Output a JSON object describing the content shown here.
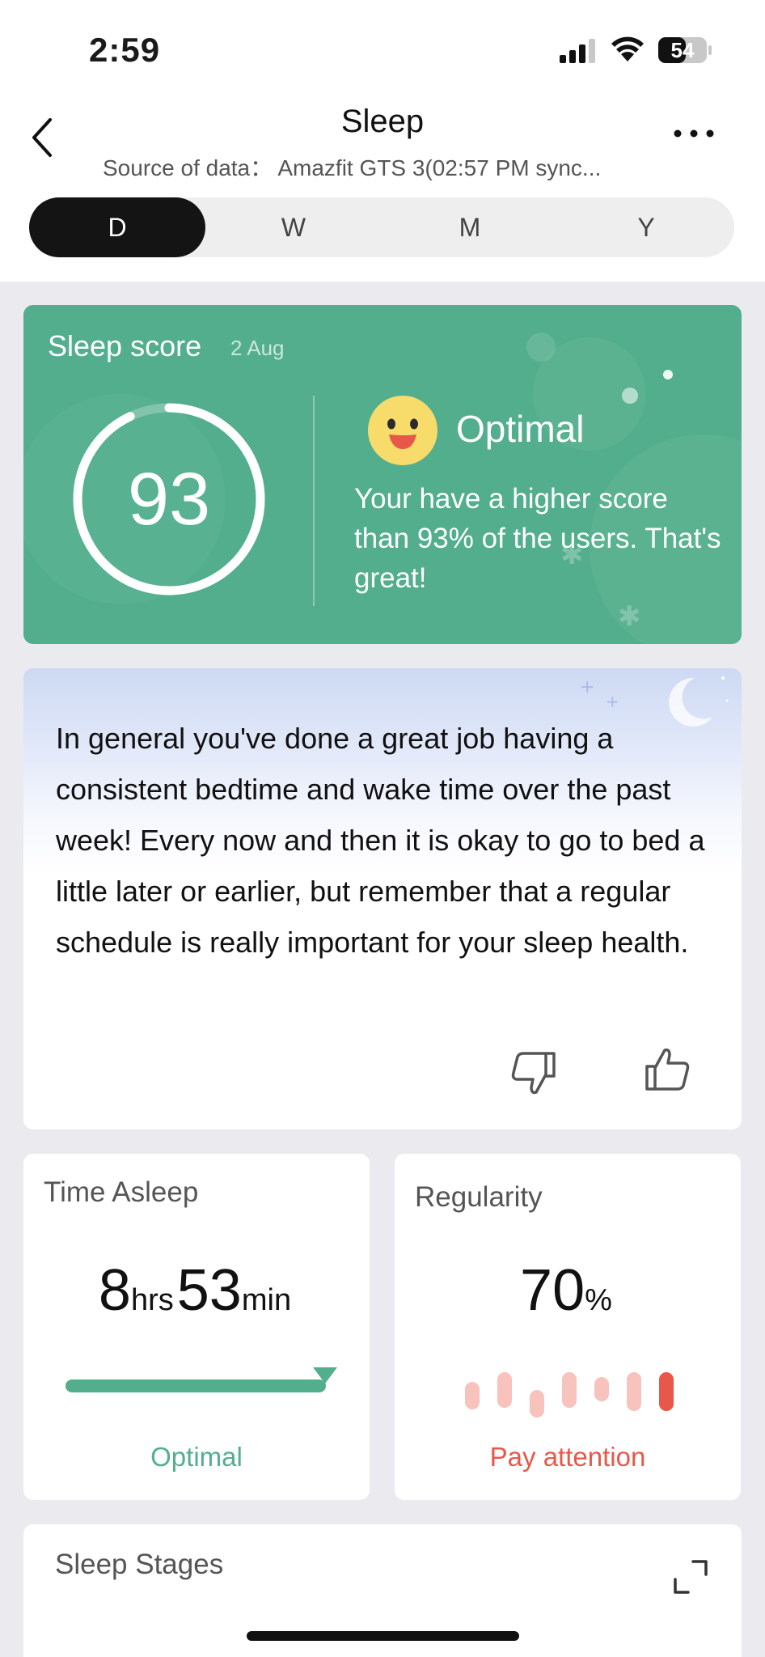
{
  "status_bar": {
    "time": "2:59",
    "battery": "54"
  },
  "header": {
    "title": "Sleep",
    "source": "Source of data： Amazfit GTS 3(02:57 PM sync..."
  },
  "period_tabs": [
    {
      "label": "D",
      "active": true
    },
    {
      "label": "W",
      "active": false
    },
    {
      "label": "M",
      "active": false
    },
    {
      "label": "Y",
      "active": false
    }
  ],
  "score_card": {
    "title": "Sleep score",
    "date": "2 Aug",
    "score": "93",
    "score_fraction": 0.93,
    "status": "Optimal",
    "description": "Your have a higher score than 93% of the users. That's great!",
    "color": "#52ae8c"
  },
  "insight": {
    "text": "In general you've done a great job having a consistent bedtime and wake time over the past week! Every now and then it is okay to go to bed a little later or earlier, but remember that a regular schedule is really important for your sleep health."
  },
  "time_asleep": {
    "label": "Time Asleep",
    "hours": "8",
    "hours_unit": "hrs",
    "minutes": "53",
    "minutes_unit": "min",
    "status": "Optimal"
  },
  "regularity": {
    "label": "Regularity",
    "value": "70",
    "unit": "%",
    "status": "Pay attention",
    "accent": "#e8574a"
  },
  "sleep_stages": {
    "title": "Sleep Stages"
  },
  "icons": [
    "back-icon",
    "more-icon",
    "signal-icon",
    "wifi-icon",
    "battery-icon",
    "smiley-icon",
    "thumb-down-icon",
    "thumb-up-icon",
    "expand-icon"
  ]
}
